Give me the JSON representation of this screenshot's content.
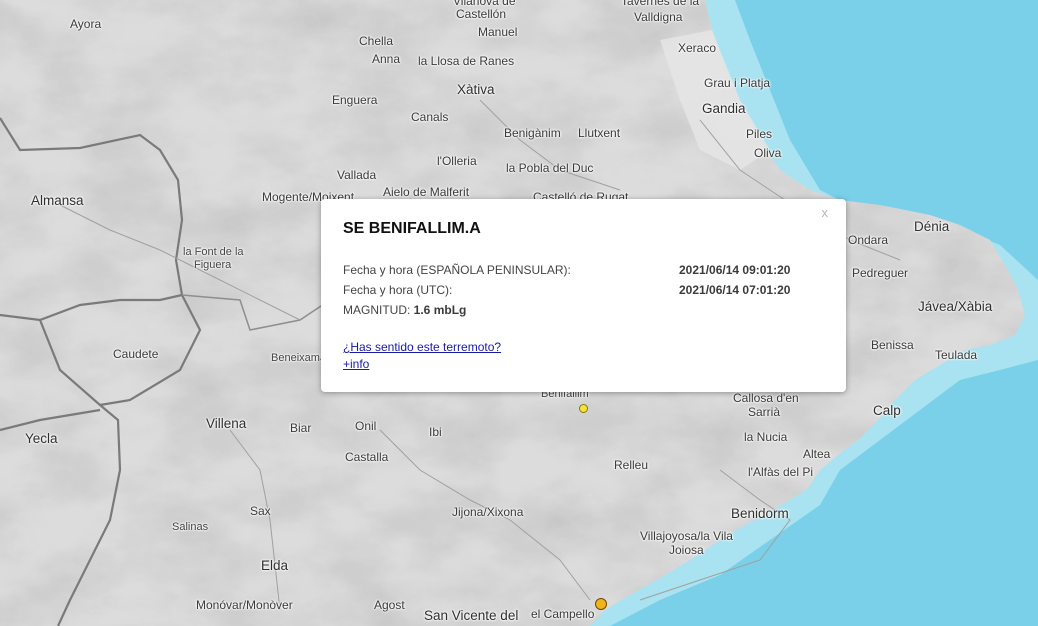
{
  "map": {
    "colors": {
      "land": "#d9d9d9",
      "sea": "#7fd3ea",
      "border": "#7a7a7a",
      "road": "#9a9a9a"
    },
    "places": [
      {
        "name": "Ayora"
      },
      {
        "name": "Vilanova de"
      },
      {
        "name": "Castellón"
      },
      {
        "name": "Manuel"
      },
      {
        "name": "Chella"
      },
      {
        "name": "Anna"
      },
      {
        "name": "la Llosa de Ranes"
      },
      {
        "name": "Tavernes de la"
      },
      {
        "name": "Valldigna"
      },
      {
        "name": "Xeraco"
      },
      {
        "name": "Grau i Platja"
      },
      {
        "name": "Gandia"
      },
      {
        "name": "Xàtiva"
      },
      {
        "name": "Enguera"
      },
      {
        "name": "Canals"
      },
      {
        "name": "Benigànim"
      },
      {
        "name": "Llutxent"
      },
      {
        "name": "Piles"
      },
      {
        "name": "Oliva"
      },
      {
        "name": "l'Olleria"
      },
      {
        "name": "la Pobla del Duc"
      },
      {
        "name": "Vallada"
      },
      {
        "name": "Almansa"
      },
      {
        "name": "Mogente/Moixent"
      },
      {
        "name": "Aielo de Malferit"
      },
      {
        "name": "Castelló de Rugat"
      },
      {
        "name": "Dénia"
      },
      {
        "name": "Ondara"
      },
      {
        "name": "Pedreguer"
      },
      {
        "name": "Jávea/Xàbia"
      },
      {
        "name": "Benissa"
      },
      {
        "name": "Teulada"
      },
      {
        "name": "la Font de la"
      },
      {
        "name": "Figuera"
      },
      {
        "name": "Caudete"
      },
      {
        "name": "Beneixama"
      },
      {
        "name": "Benifallim"
      },
      {
        "name": "Callosa d'en"
      },
      {
        "name": "Sarrià"
      },
      {
        "name": "Calp"
      },
      {
        "name": "la Nucia"
      },
      {
        "name": "Yecla"
      },
      {
        "name": "Villena"
      },
      {
        "name": "Biar"
      },
      {
        "name": "Onil"
      },
      {
        "name": "Ibi"
      },
      {
        "name": "Castalla"
      },
      {
        "name": "Relleu"
      },
      {
        "name": "Altea"
      },
      {
        "name": "l'Alfàs del Pi"
      },
      {
        "name": "Benidorm"
      },
      {
        "name": "Sax"
      },
      {
        "name": "Jijona/Xixona"
      },
      {
        "name": "Salinas"
      },
      {
        "name": "Villajoyosa/la Vila"
      },
      {
        "name": "Joiosa"
      },
      {
        "name": "Elda"
      },
      {
        "name": "Monóvar/Monòver"
      },
      {
        "name": "Agost"
      },
      {
        "name": "San Vicente del"
      },
      {
        "name": "el Campello"
      }
    ]
  },
  "popup": {
    "close_label": "x",
    "title": "SE BENIFALLIM.A",
    "local_time_label": "Fecha y hora (ESPAÑOLA PENINSULAR):",
    "local_time_value": "2021/06/14 09:01:20",
    "utc_label": "Fecha y hora (UTC):",
    "utc_value": "2021/06/14 07:01:20",
    "magnitude_label": "MAGNITUD:",
    "magnitude_value": "1.6 mbLg",
    "felt_link": "¿Has sentido este terremoto?",
    "info_link": "+info"
  },
  "quakes": [
    {
      "magnitude": "1.6 mbLg",
      "color": "#f2e43a"
    },
    {
      "color": "#f0b41a"
    }
  ]
}
